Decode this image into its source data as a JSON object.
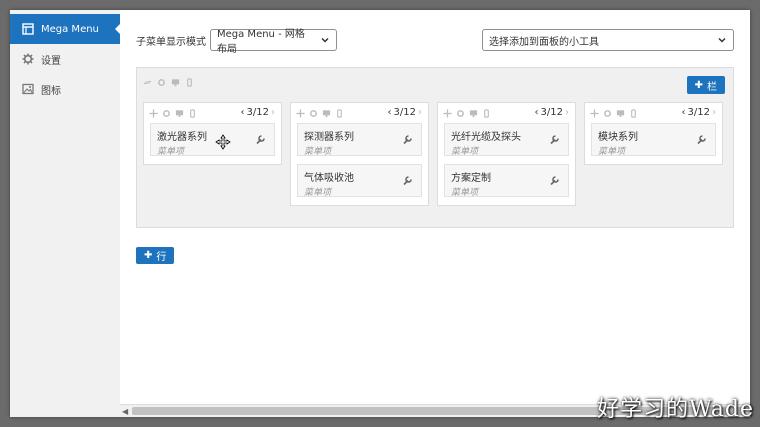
{
  "sidebar": {
    "items": [
      {
        "label": "Mega Menu",
        "icon": "menu-grid-icon",
        "active": true
      },
      {
        "label": "设置",
        "icon": "gear-icon",
        "active": false
      },
      {
        "label": "图标",
        "icon": "image-icon",
        "active": false
      }
    ]
  },
  "toolbar": {
    "submenu_mode_label": "子菜单显示模式",
    "submenu_mode_value": "Mega Menu - 网格布局",
    "widget_select_placeholder": "选择添加到面板的小工具"
  },
  "grid": {
    "add_column_label": "栏",
    "columns": [
      {
        "width": "3/12",
        "items": [
          {
            "title": "激光器系列",
            "subtitle": "菜单项"
          }
        ]
      },
      {
        "width": "3/12",
        "items": [
          {
            "title": "探测器系列",
            "subtitle": "菜单项"
          },
          {
            "title": "气体吸收池",
            "subtitle": "菜单项"
          }
        ]
      },
      {
        "width": "3/12",
        "items": [
          {
            "title": "光纤光缆及探头",
            "subtitle": "菜单项"
          },
          {
            "title": "方案定制",
            "subtitle": "菜单项"
          }
        ]
      },
      {
        "width": "3/12",
        "items": [
          {
            "title": "模块系列",
            "subtitle": "菜单项"
          }
        ]
      }
    ]
  },
  "add_row_label": "行",
  "watermark": "好学习的Wade",
  "colors": {
    "accent": "#1e73be",
    "panel": "#f0f0f1"
  }
}
